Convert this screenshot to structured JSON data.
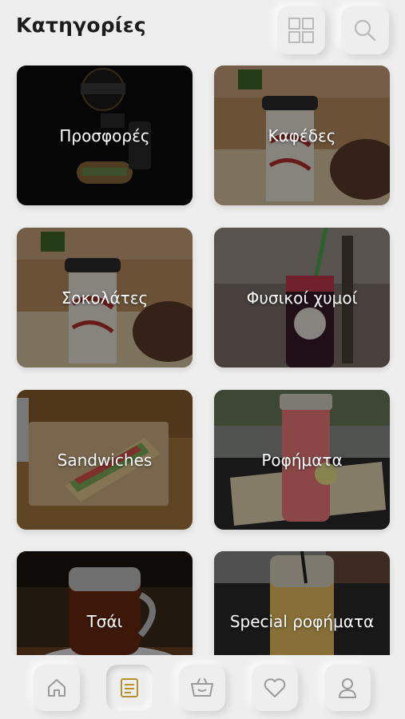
{
  "header": {
    "title": "Κατηγορίες",
    "grid_icon": "grid-icon",
    "search_icon": "search-icon"
  },
  "categories": [
    {
      "label": "Προσφορές"
    },
    {
      "label": "Καφέδες"
    },
    {
      "label": "Σοκολάτες"
    },
    {
      "label": "Φυσικοί χυμοί"
    },
    {
      "label": "Sandwiches"
    },
    {
      "label": "Ροφήματα"
    },
    {
      "label": "Τσάι"
    },
    {
      "label": "Special ροφήματα"
    }
  ],
  "nav": {
    "items": [
      {
        "icon": "home-icon"
      },
      {
        "icon": "menu-icon",
        "active": true
      },
      {
        "icon": "basket-icon"
      },
      {
        "icon": "heart-icon"
      },
      {
        "icon": "user-icon"
      }
    ],
    "icon_color": "#9a9a9a",
    "active_color": "#b8902e"
  },
  "colors": {
    "background": "#eeeeee",
    "title": "#1c1c1c"
  }
}
